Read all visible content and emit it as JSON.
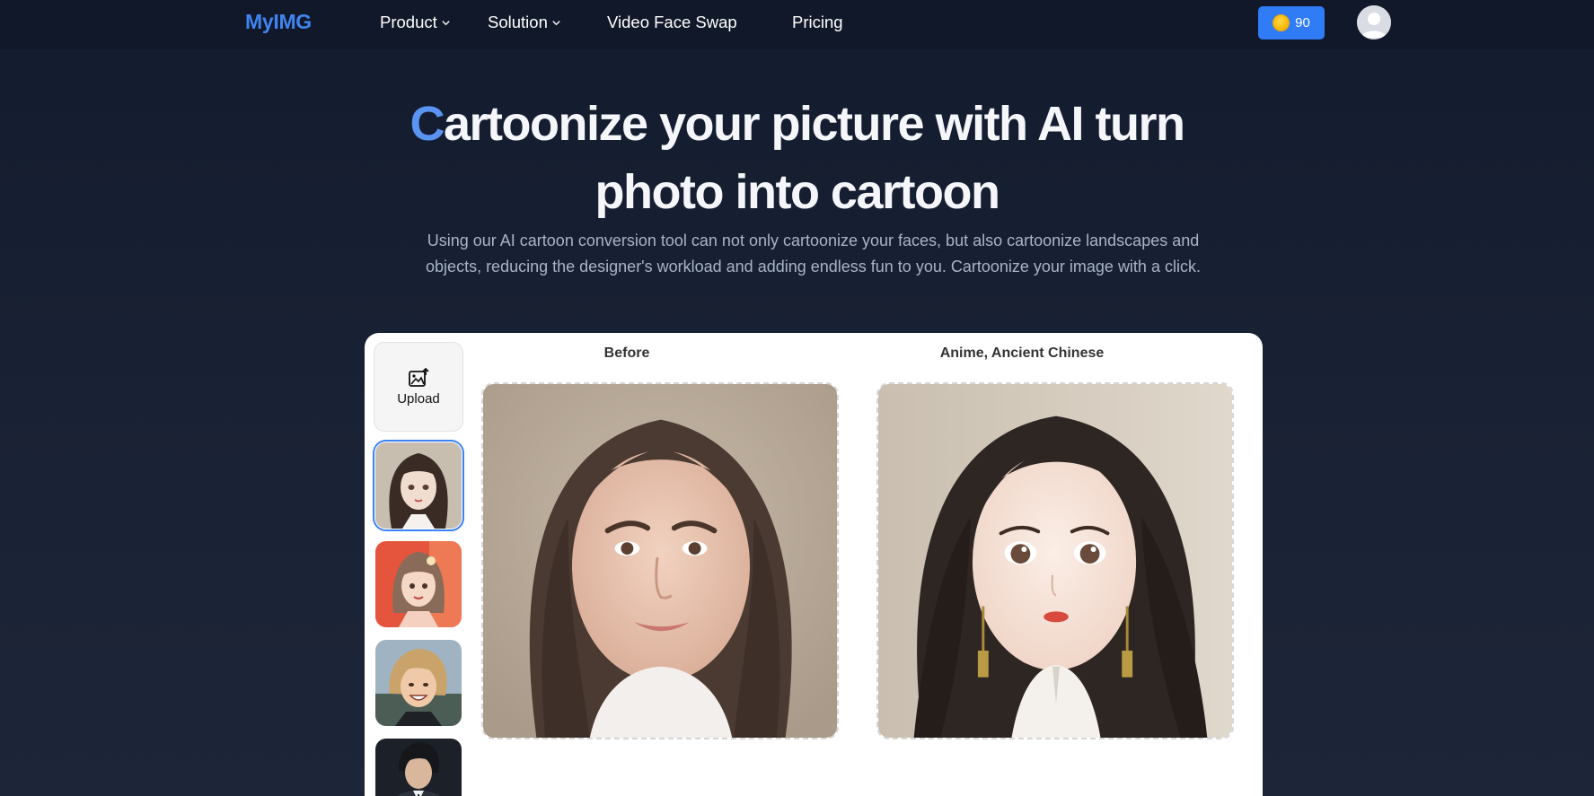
{
  "nav": {
    "logo": "MyIMG",
    "items": [
      {
        "label": "Product",
        "dropdown": true
      },
      {
        "label": "Solution",
        "dropdown": true
      },
      {
        "label": "Video Face Swap",
        "dropdown": false
      },
      {
        "label": "Pricing",
        "dropdown": false
      }
    ],
    "coins": "90",
    "avatar_icon": "user-avatar-icon"
  },
  "hero": {
    "title_first_letter": "C",
    "title_rest": "artoonize your picture with AI turn photo into cartoon",
    "description": "Using our AI cartoon conversion tool can not only cartoonize your faces, but also cartoonize landscapes and objects, reducing the designer's workload and adding endless fun to you. Cartoonize your image with a click."
  },
  "tool": {
    "upload_label": "Upload",
    "before_label": "Before",
    "after_label": "Anime, Ancient Chinese",
    "thumbnails": [
      "anime-girl-long-hair",
      "anime-girl-red-background",
      "anime-boy-smiling",
      "anime-man-suit"
    ],
    "selected_thumbnail": 0
  },
  "colors": {
    "accent": "#3f84f0",
    "coin_button": "#2f7cf6",
    "background": "#131b2e"
  }
}
